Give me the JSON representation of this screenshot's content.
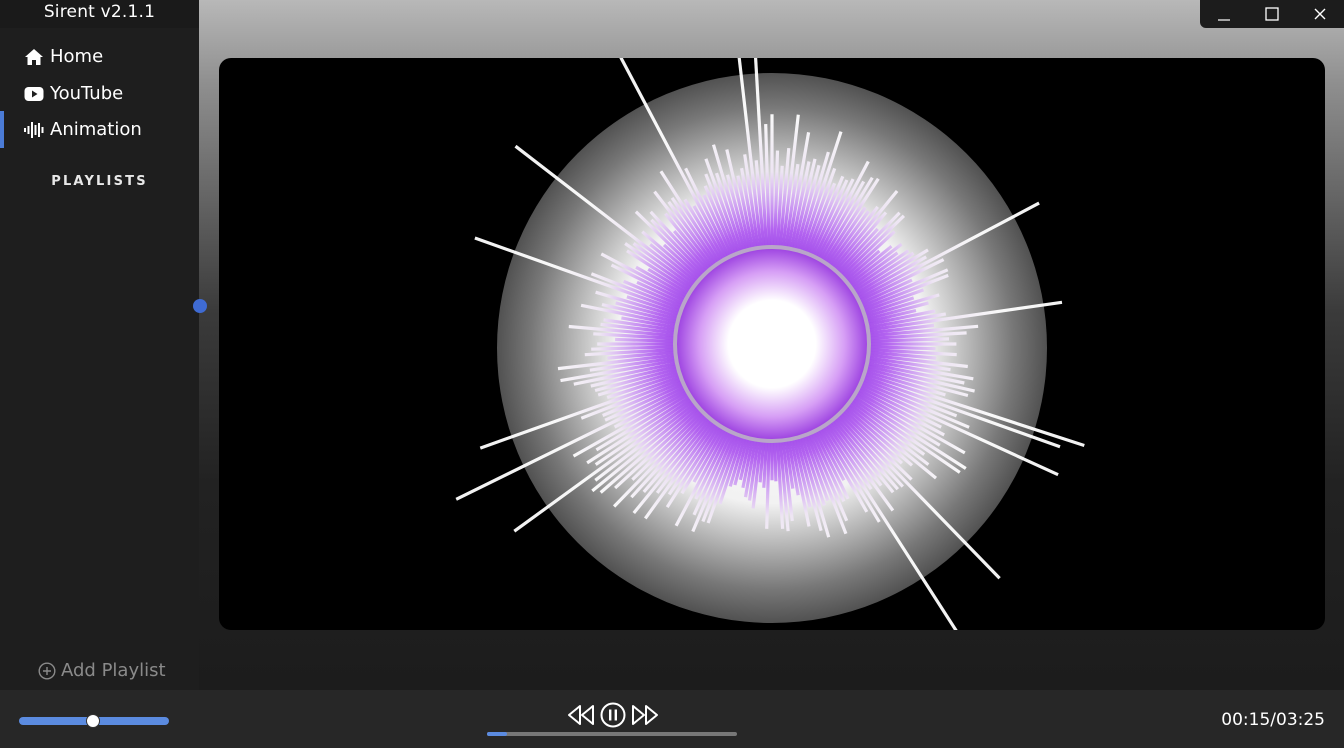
{
  "app": {
    "title": "Sirent v2.1.1"
  },
  "sidebar": {
    "nav": [
      {
        "label": "Home",
        "icon": "home-icon"
      },
      {
        "label": "YouTube",
        "icon": "youtube-icon"
      },
      {
        "label": "Animation",
        "icon": "audio-wave-icon",
        "active": true
      }
    ],
    "playlists_heading": "PLAYLISTS",
    "add_playlist_label": "Add Playlist"
  },
  "window_controls": [
    "minimize-icon",
    "maximize-icon",
    "close-icon"
  ],
  "visualizer": {
    "accent": "#8a2be2",
    "ring_color": "#b9a6c9",
    "bar_tip_color": "#efe6f5"
  },
  "player": {
    "volume": 0.49,
    "progress": 0.08,
    "current_time": "00:15",
    "separator": "/",
    "total_time": "03:25"
  },
  "colors": {
    "accent_blue": "#5b8be0",
    "sidebar_bg": "#1e1e1e",
    "player_bg": "#272727"
  }
}
